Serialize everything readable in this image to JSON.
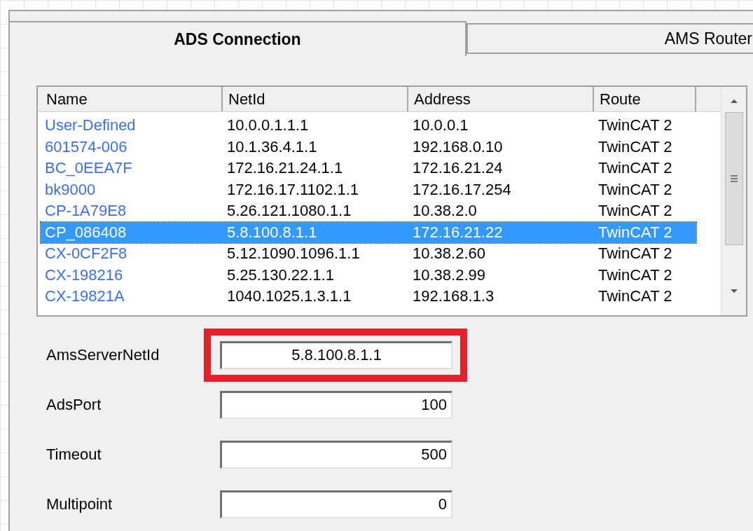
{
  "tabs": [
    {
      "label": "ADS Connection",
      "selected": true
    },
    {
      "label": "AMS Router",
      "selected": false
    }
  ],
  "table": {
    "columns": [
      "Name",
      "NetId",
      "Address",
      "Route"
    ],
    "rows": [
      {
        "cells": [
          "User-Defined",
          "10.0.0.1.1.1",
          "10.0.0.1",
          "TwinCAT 2"
        ],
        "selected": false
      },
      {
        "cells": [
          "601574-006",
          "10.1.36.4.1.1",
          "192.168.0.10",
          "TwinCAT 2"
        ],
        "selected": false
      },
      {
        "cells": [
          "BC_0EEA7F",
          "172.16.21.24.1.1",
          "172.16.21.24",
          "TwinCAT 2"
        ],
        "selected": false
      },
      {
        "cells": [
          "bk9000",
          "172.16.17.1102.1.1",
          "172.16.17.254",
          "TwinCAT 2"
        ],
        "selected": false
      },
      {
        "cells": [
          "CP-1A79E8",
          "5.26.121.1080.1.1",
          "10.38.2.0",
          "TwinCAT 2"
        ],
        "selected": false
      },
      {
        "cells": [
          "CP_086408",
          "5.8.100.8.1.1",
          "172.16.21.22",
          "TwinCAT 2"
        ],
        "selected": true
      },
      {
        "cells": [
          "CX-0CF2F8",
          "5.12.1090.1096.1.1",
          "10.38.2.60",
          "TwinCAT 2"
        ],
        "selected": false
      },
      {
        "cells": [
          "CX-198216",
          "5.25.130.22.1.1",
          "10.38.2.99",
          "TwinCAT 2"
        ],
        "selected": false
      },
      {
        "cells": [
          "CX-19821A",
          "1040.1025.1.3.1.1",
          "192.168.1.3",
          "TwinCAT 2"
        ],
        "selected": false
      }
    ]
  },
  "fields": [
    {
      "label": "AmsServerNetId",
      "value": "5.8.100.8.1.1",
      "kind": "address",
      "highlighted": true
    },
    {
      "label": "AdsPort",
      "value": "100",
      "kind": "number",
      "highlighted": false
    },
    {
      "label": "Timeout",
      "value": "500",
      "kind": "number",
      "highlighted": false
    },
    {
      "label": "Multipoint",
      "value": "0",
      "kind": "number",
      "highlighted": false
    }
  ]
}
